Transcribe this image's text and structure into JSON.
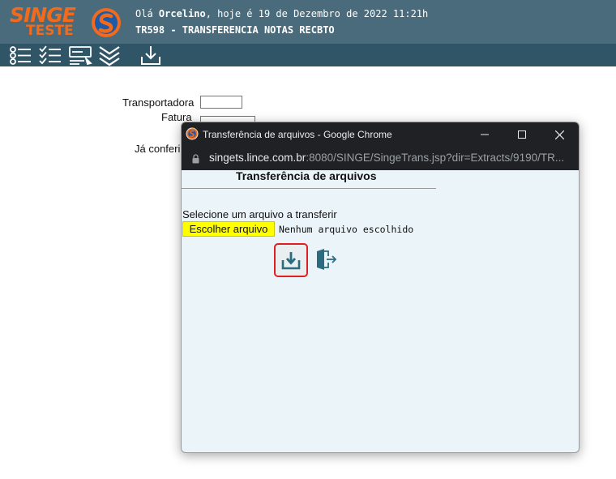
{
  "header": {
    "logo_main": "SINGE",
    "logo_sub": "TESTE",
    "greeting_prefix": "Olá ",
    "user_name": "Orcelino",
    "greeting_suffix": ", hoje é 19 de Dezembro de 2022 11:21h",
    "screen_title": "TR598 - TRANSFERENCIA NOTAS RECBTO"
  },
  "colors": {
    "header_bg": "#4a6b7c",
    "toolbar_bg": "#2f5566",
    "logo_orange": "#f26a1b",
    "popup_bg": "#eaf4f9",
    "choose_button": "#ffff00",
    "highlight_red": "#e02020",
    "icon_teal": "#2b6b80"
  },
  "toolbar": {
    "icons": [
      "list-select-icon",
      "checklist-icon",
      "form-icon",
      "double-chevron-down-icon",
      "download-icon"
    ]
  },
  "form": {
    "transportadora_label": "Transportadora",
    "fatura_label": "Fatura",
    "ja_conferido_label": "Já conferi"
  },
  "popup": {
    "window_title": "Transferência de arquivos - Google Chrome",
    "url_host": "singets.lince.com.br",
    "url_rest": ":8080/SINGE/SingeTrans.jsp?dir=Extracts/9190/TR...",
    "heading": "Transferência de arquivos",
    "instruction": "Selecione um arquivo a transferir",
    "choose_button": "Escolher arquivo",
    "no_file": "Nenhum arquivo escolhido"
  }
}
